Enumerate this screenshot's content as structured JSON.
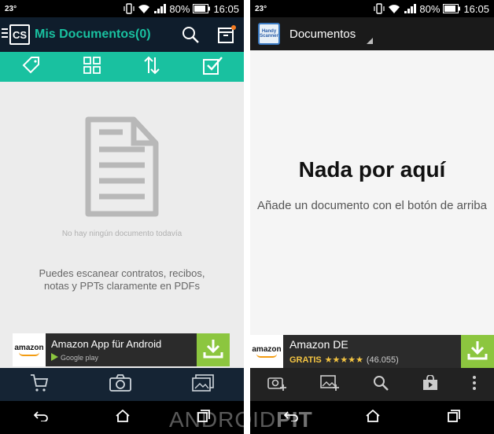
{
  "left": {
    "status": {
      "temp": "23°",
      "battery": "80%",
      "time": "16:05"
    },
    "header": {
      "logo": "CS",
      "title": "Mis Documentos(0)"
    },
    "empty_text": "No hay ningún documento todavía",
    "hint": "Puedes escanear contratos, recibos, notas y PPTs claramente en PDFs",
    "ad": {
      "logo": "amazon",
      "title": "Amazon App für Android",
      "store": "Google play"
    }
  },
  "right": {
    "status": {
      "temp": "23°",
      "battery": "80%",
      "time": "16:05"
    },
    "header": {
      "icon_text": "Handy Scanner",
      "title": "Documentos"
    },
    "big_title": "Nada por aquí",
    "hint": "Añade un documento con el botón de arriba",
    "ad": {
      "logo": "amazon",
      "title": "Amazon DE",
      "gratis": "GRATIS",
      "stars": "★★★★★",
      "count": "(46.055)"
    }
  },
  "watermark": {
    "a": "ANDROID",
    "b": "PIT"
  },
  "colors": {
    "teal": "#19c1a0",
    "navy": "#0f1d2c",
    "green": "#8cc63f"
  }
}
